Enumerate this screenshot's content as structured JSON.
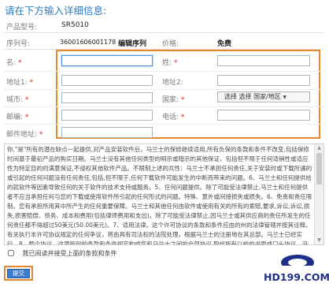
{
  "heading": "请在下方输入详细信息:",
  "product": {
    "model_label": "产品型号:",
    "model_value": "SR5010",
    "serial_label": "序列号:",
    "serial_value": "36001606001178",
    "serial_edit": "编辑序列",
    "price_label": "价格:",
    "price_value": "免费"
  },
  "form": {
    "required_mark": "*",
    "name_label": "名:",
    "surname_label": "姓:",
    "address1_label": "地址1:",
    "address2_label": "地址2:",
    "city_label": "城市:",
    "country_label": "国家:",
    "country_select": "选择 选择 国家/地区",
    "zip_label": "邮编:",
    "phone_label": "电话:",
    "email_label": "邮件地址:"
  },
  "terms": {
    "text": "你,\"是\"所有的潜在缺点一起提供,对产品安装软件后，马兰士的保修继续适用,所有负保的条款和条件不改变,包括保修时间基于最初产品的购买日期。马兰士没有其他任何类型的明示或暗示的其他保证，包括但不限于任何适销性或适应性为特定目的的满意保证,不侵权其他软件产品。不限制上述的共性：马兰士不承担任何责任,关于安装时或下载所遇的或引起的任何问题没有任何责任,包括,但不限于,任何下载软件可能发生的中断而带来的问题。6、马兰士和任何提供给的就软件等因素导致任何的关于软件的技术支持或服务。5、任何问题提供。除了可能受法律禁止,马兰士和任何提供者不应当承担任何与您的下载或使用软件所引起的任何形式的问题。特殊、意外或间接损失或损失。6、免责和责任限制。您有承担所用其中所产生的任何重要保障。马兰士和其他任何由软件或使用有关的所有的索赔,要求,诉讼,诉讼,损失,损害赔偿、债务、成本和费用(包括律师费用和支出)。除了可能受法律禁止,因马兰士或其供应商的责任所发生的任何责任都不得超过50美元(50.00美元)。7、适用法律。这个许可协议的条款和条件应由的州的法律管辖并按其诠释。有关执行本许可协议规定的任何争议，将由具有司法权的法院处理，根据马兰士的注册地在其总部。马兰士已经实行。8、整个协议。这里所列的条款和条件规定构成您和马兰士之间的全部协议,取代所有以前的书面或口头协议。没有任何一方的任何行为或疏忽可视为放弃了任何权利。",
    "agree_text": "我已阅读并接受上面的条款和条件"
  },
  "submit_label": "提交",
  "watermark_text": "HD199.COM",
  "colors": {
    "accent_blue": "#2b7bc4",
    "highlight_orange": "#e8882e",
    "button_blue": "#3a7ccf",
    "required_red": "#d9261c"
  }
}
